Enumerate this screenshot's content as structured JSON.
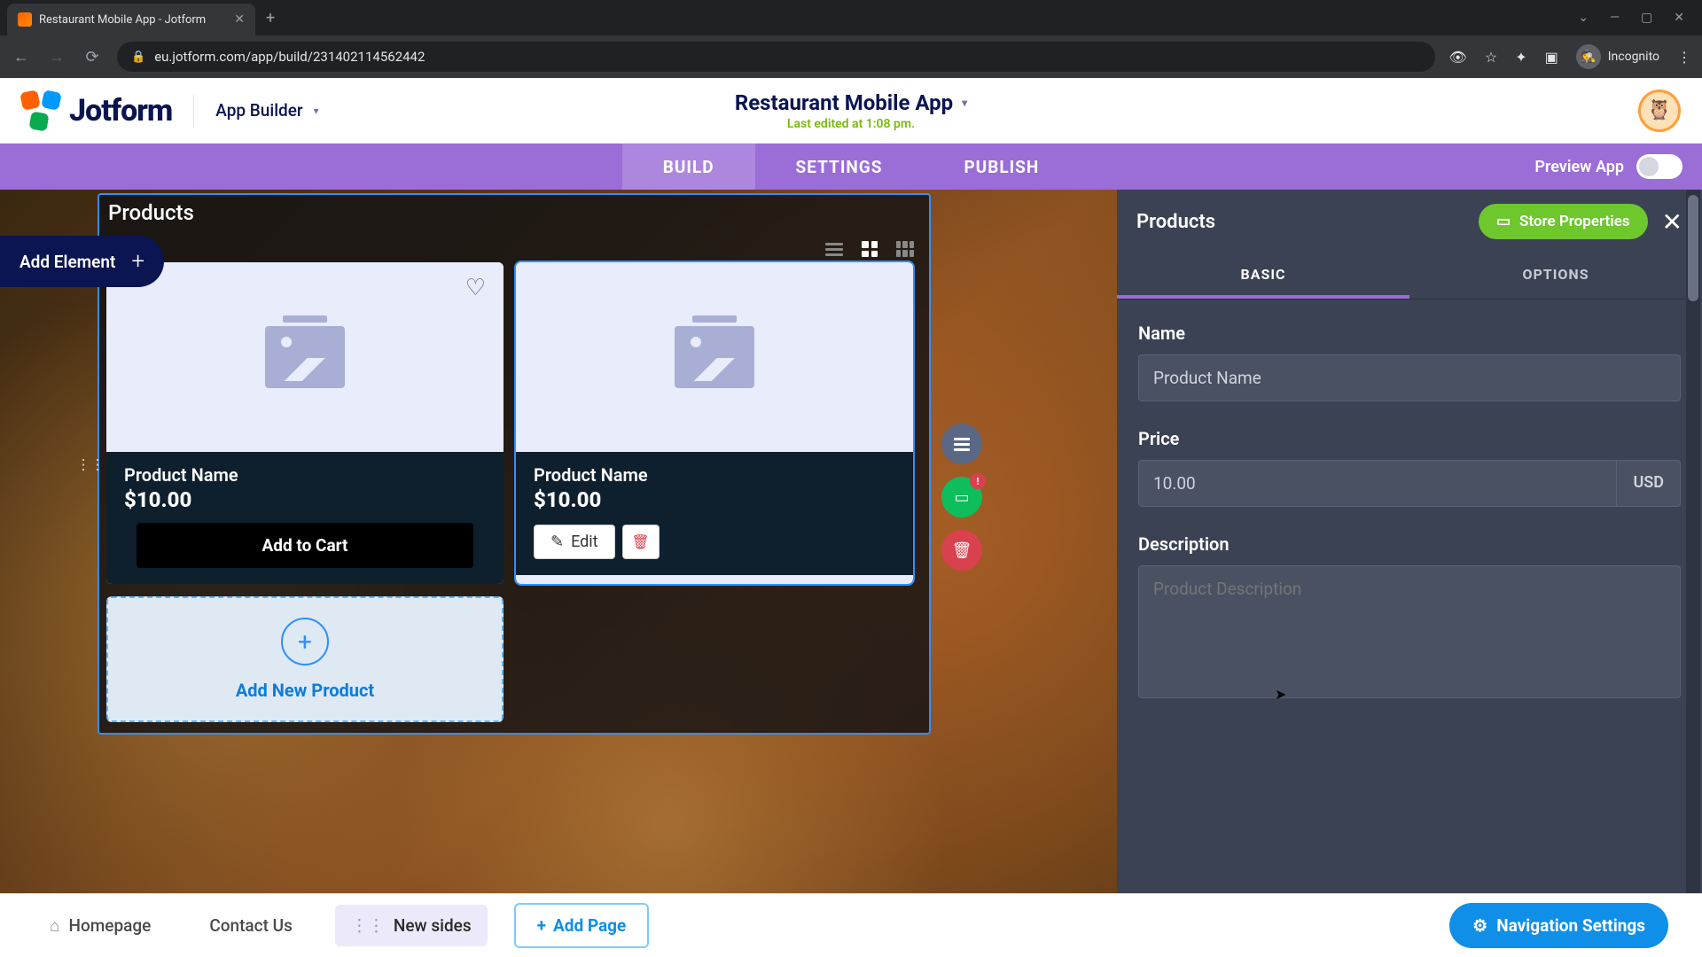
{
  "browser": {
    "tab_title": "Restaurant Mobile App - Jotform",
    "url": "eu.jotform.com/app/build/231402114562442",
    "incognito_label": "Incognito"
  },
  "header": {
    "logo_text": "Jotform",
    "app_builder_label": "App Builder",
    "app_title": "Restaurant Mobile App",
    "last_edited": "Last edited at 1:08 pm."
  },
  "tabs": {
    "build": "BUILD",
    "settings": "SETTINGS",
    "publish": "PUBLISH",
    "preview_label": "Preview App"
  },
  "add_element_label": "Add Element",
  "products_editor": {
    "heading": "Products",
    "card1": {
      "name": "Product Name",
      "price": "$10.00",
      "cta": "Add to Cart"
    },
    "card2": {
      "name": "Product Name",
      "price": "$10.00",
      "edit": "Edit"
    },
    "add_new": "Add New Product"
  },
  "float_badge": "!",
  "props": {
    "title": "Products",
    "store_btn": "Store Properties",
    "tab_basic": "BASIC",
    "tab_options": "OPTIONS",
    "name_label": "Name",
    "name_value": "Product Name",
    "price_label": "Price",
    "price_value": "10.00",
    "currency": "USD",
    "desc_label": "Description",
    "desc_placeholder": "Product Description"
  },
  "pages": {
    "home": "Homepage",
    "contact": "Contact Us",
    "newsides": "New sides",
    "add_page": "Add Page",
    "nav_settings": "Navigation Settings"
  }
}
